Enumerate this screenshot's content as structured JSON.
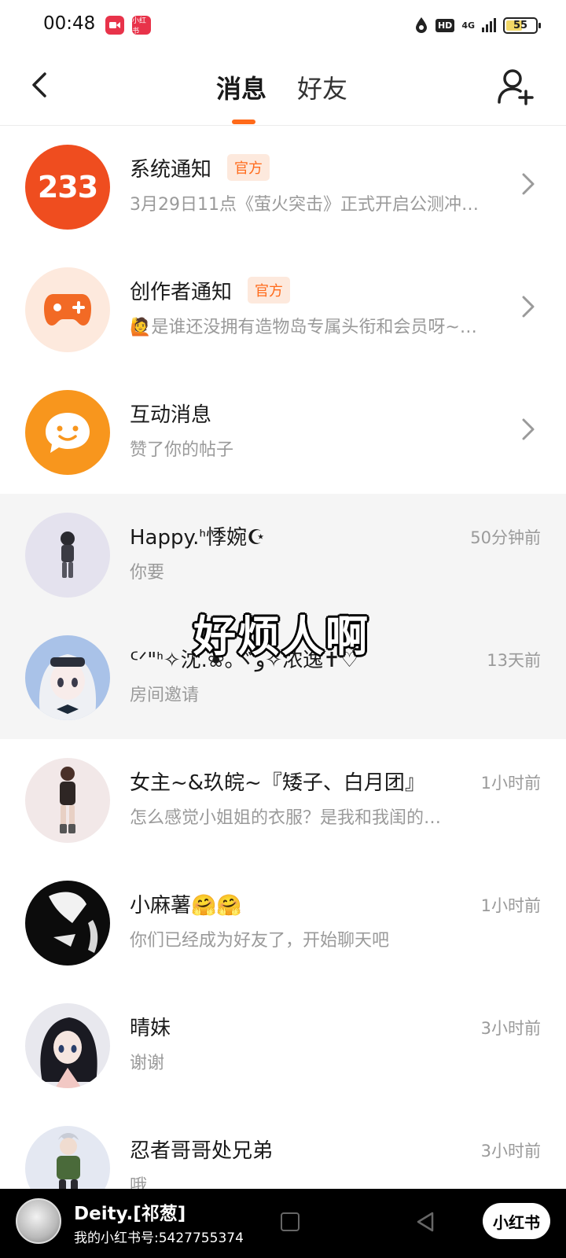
{
  "status_bar": {
    "time": "00:48",
    "hd": "HD",
    "network": "4G",
    "battery": "55",
    "battery_level": 0.55,
    "app_badge_2": "小红书"
  },
  "header": {
    "tabs": [
      {
        "label": "消息",
        "active": true
      },
      {
        "label": "好友",
        "active": false
      }
    ],
    "accent_color": "#ff6a1a"
  },
  "messages": [
    {
      "title": "系统通知",
      "badge": "官方",
      "preview": "3月29日11点《萤火突击》正式开启公测冲…",
      "avatar_text": "233"
    },
    {
      "title": "创作者通知",
      "badge": "官方",
      "preview": "🙋是谁还没拥有造物岛专属头衔和会员呀~…"
    },
    {
      "title": "互动消息",
      "preview": "赞了你的帖子"
    },
    {
      "title": "Happy.ᑋ悸婉☪",
      "time": "50分钟前",
      "preview": "你要"
    },
    {
      "title": "ᑦᐟ\"ᑋ✧沈.❀｡ヾو✧浓逸✝♡",
      "time": "13天前",
      "preview": "房间邀请"
    },
    {
      "title": "女主~&玖皖~『矮子、白月团』",
      "time": "1小时前",
      "preview": "怎么感觉小姐姐的衣服？是我和我闺的…"
    },
    {
      "title": "小麻薯🤗🤗",
      "time": "1小时前",
      "preview": "你们已经成为好友了，开始聊天吧"
    },
    {
      "title": "晴妹",
      "time": "3小时前",
      "preview": "谢谢"
    },
    {
      "title": "忍者哥哥处兄弟",
      "time": "3小时前",
      "preview": "哦"
    }
  ],
  "overlay": {
    "caption": "好烦人啊"
  },
  "watermark": {
    "name": "Deity.[祁葱]",
    "id_line": "我的小红书号:5427755374",
    "logo": "小红书"
  }
}
